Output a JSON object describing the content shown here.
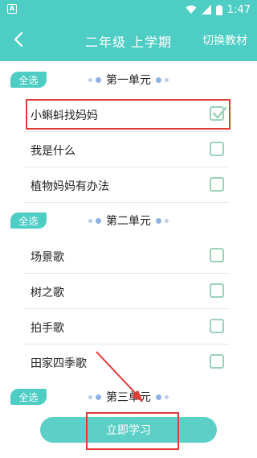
{
  "status": {
    "time": "1:47",
    "app_badge": "A"
  },
  "appbar": {
    "title": "二年级  上学期",
    "switch_label": "切换教材"
  },
  "units": [
    {
      "select_all": "全选",
      "title": "第一单元",
      "lessons": [
        {
          "label": "小蝌蚪找妈妈",
          "checked": true
        },
        {
          "label": "我是什么",
          "checked": false
        },
        {
          "label": "植物妈妈有办法",
          "checked": false
        }
      ]
    },
    {
      "select_all": "全选",
      "title": "第二单元",
      "lessons": [
        {
          "label": "场景歌",
          "checked": false
        },
        {
          "label": "树之歌",
          "checked": false
        },
        {
          "label": "拍手歌",
          "checked": false
        },
        {
          "label": "田家四季歌",
          "checked": false
        }
      ]
    },
    {
      "select_all": "全选",
      "title": "第三单元",
      "lessons": []
    }
  ],
  "footer": {
    "study_label": "立即学习"
  },
  "colors": {
    "accent": "#4ecdc4",
    "highlight": "#e53935",
    "checkbox": "#9ad3b8"
  }
}
